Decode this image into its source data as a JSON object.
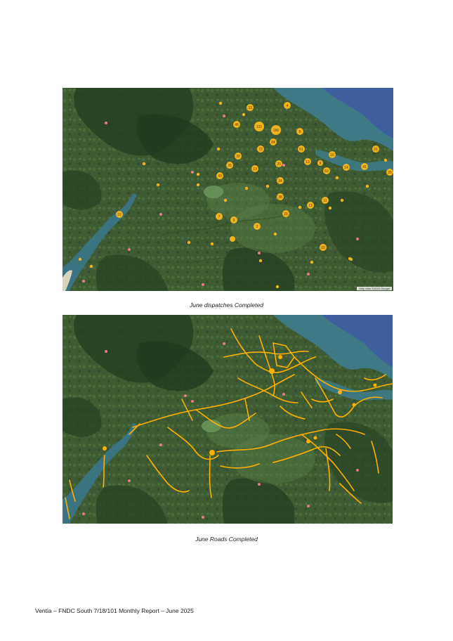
{
  "maps": {
    "dispatches": {
      "caption": "June dispatches Completed",
      "attribution": "Map data ©2025 Google",
      "cluster_labels": [
        "4",
        "33",
        "46",
        "121",
        "186",
        "84",
        "8",
        "72",
        "39",
        "35",
        "13",
        "51",
        "13",
        "20",
        "16",
        "9",
        "63",
        "14",
        "41",
        "21",
        "25",
        "43",
        "34",
        "38",
        "13",
        "11",
        "23",
        "22",
        "7",
        "9",
        "2",
        "22"
      ]
    },
    "roads": {
      "caption": "June Roads Completed"
    }
  },
  "footer": {
    "text": "Ventia – FNDC South 7/18/101 Monthly Report – June 2025"
  },
  "colors": {
    "land": "#3f5b34",
    "forest": "#263f22",
    "water": "#3e5e9e",
    "estuary": "#3d7a86",
    "marker": "#f2b21b",
    "road": "#ffb000"
  }
}
